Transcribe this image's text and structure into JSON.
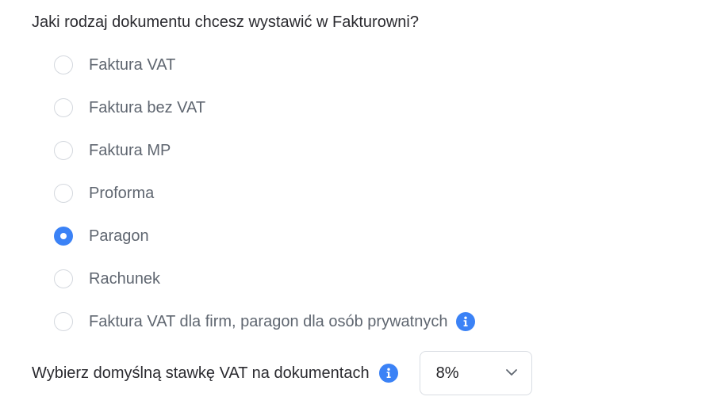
{
  "question": "Jaki rodzaj dokumentu chcesz wystawić w Fakturowni?",
  "document_types": [
    {
      "label": "Faktura VAT",
      "checked": false
    },
    {
      "label": "Faktura bez VAT",
      "checked": false
    },
    {
      "label": "Faktura MP",
      "checked": false
    },
    {
      "label": "Proforma",
      "checked": false
    },
    {
      "label": "Paragon",
      "checked": true
    },
    {
      "label": "Rachunek",
      "checked": false
    },
    {
      "label": "Faktura VAT dla firm, paragon dla osób prywatnych",
      "checked": false,
      "info_icon": "info-icon"
    }
  ],
  "vat": {
    "label": "Wybierz domyślną stawkę VAT na dokumentach",
    "selected": "8%",
    "icon": "chevron-down-icon"
  },
  "colors": {
    "accent": "#3b82f6",
    "text": "#2b2b30",
    "option_text": "#5f6670",
    "radio_border": "#d4d8de"
  }
}
